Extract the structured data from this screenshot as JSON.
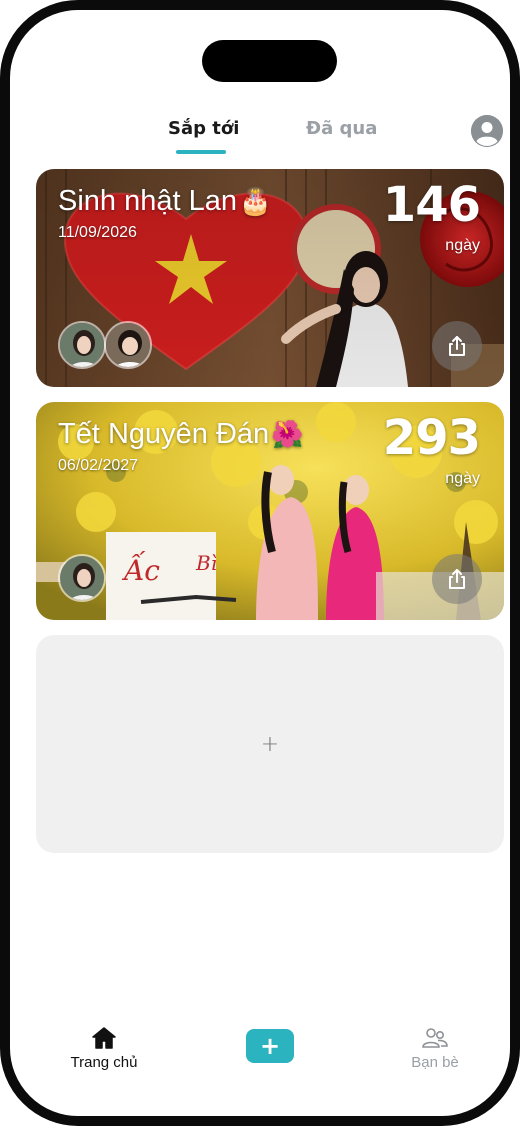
{
  "tabs": {
    "upcoming": "Sắp tới",
    "past": "Đã qua",
    "active": "upcoming"
  },
  "header": {
    "profile_icon": "user-icon"
  },
  "events": [
    {
      "title": "Sinh nhật Lan",
      "emoji": "🎂",
      "date": "11/09/2026",
      "days": "146",
      "days_unit": "ngày",
      "share_icon": "share-icon"
    },
    {
      "title": "Tết Nguyên Đán",
      "emoji": "🌺",
      "date": "06/02/2027",
      "days": "293",
      "days_unit": "ngày",
      "share_icon": "share-icon"
    }
  ],
  "add_card": {
    "plus": "+"
  },
  "bottom_nav": {
    "home_label": "Trang chủ",
    "home_icon": "home-icon",
    "add_icon": "plus-icon",
    "add_symbol": "+",
    "friends_label": "Bạn bè",
    "friends_icon": "friends-icon"
  },
  "colors": {
    "accent": "#2bb3c0",
    "inactive": "#9aa0a6",
    "add_card_bg": "#f0f0f0"
  }
}
